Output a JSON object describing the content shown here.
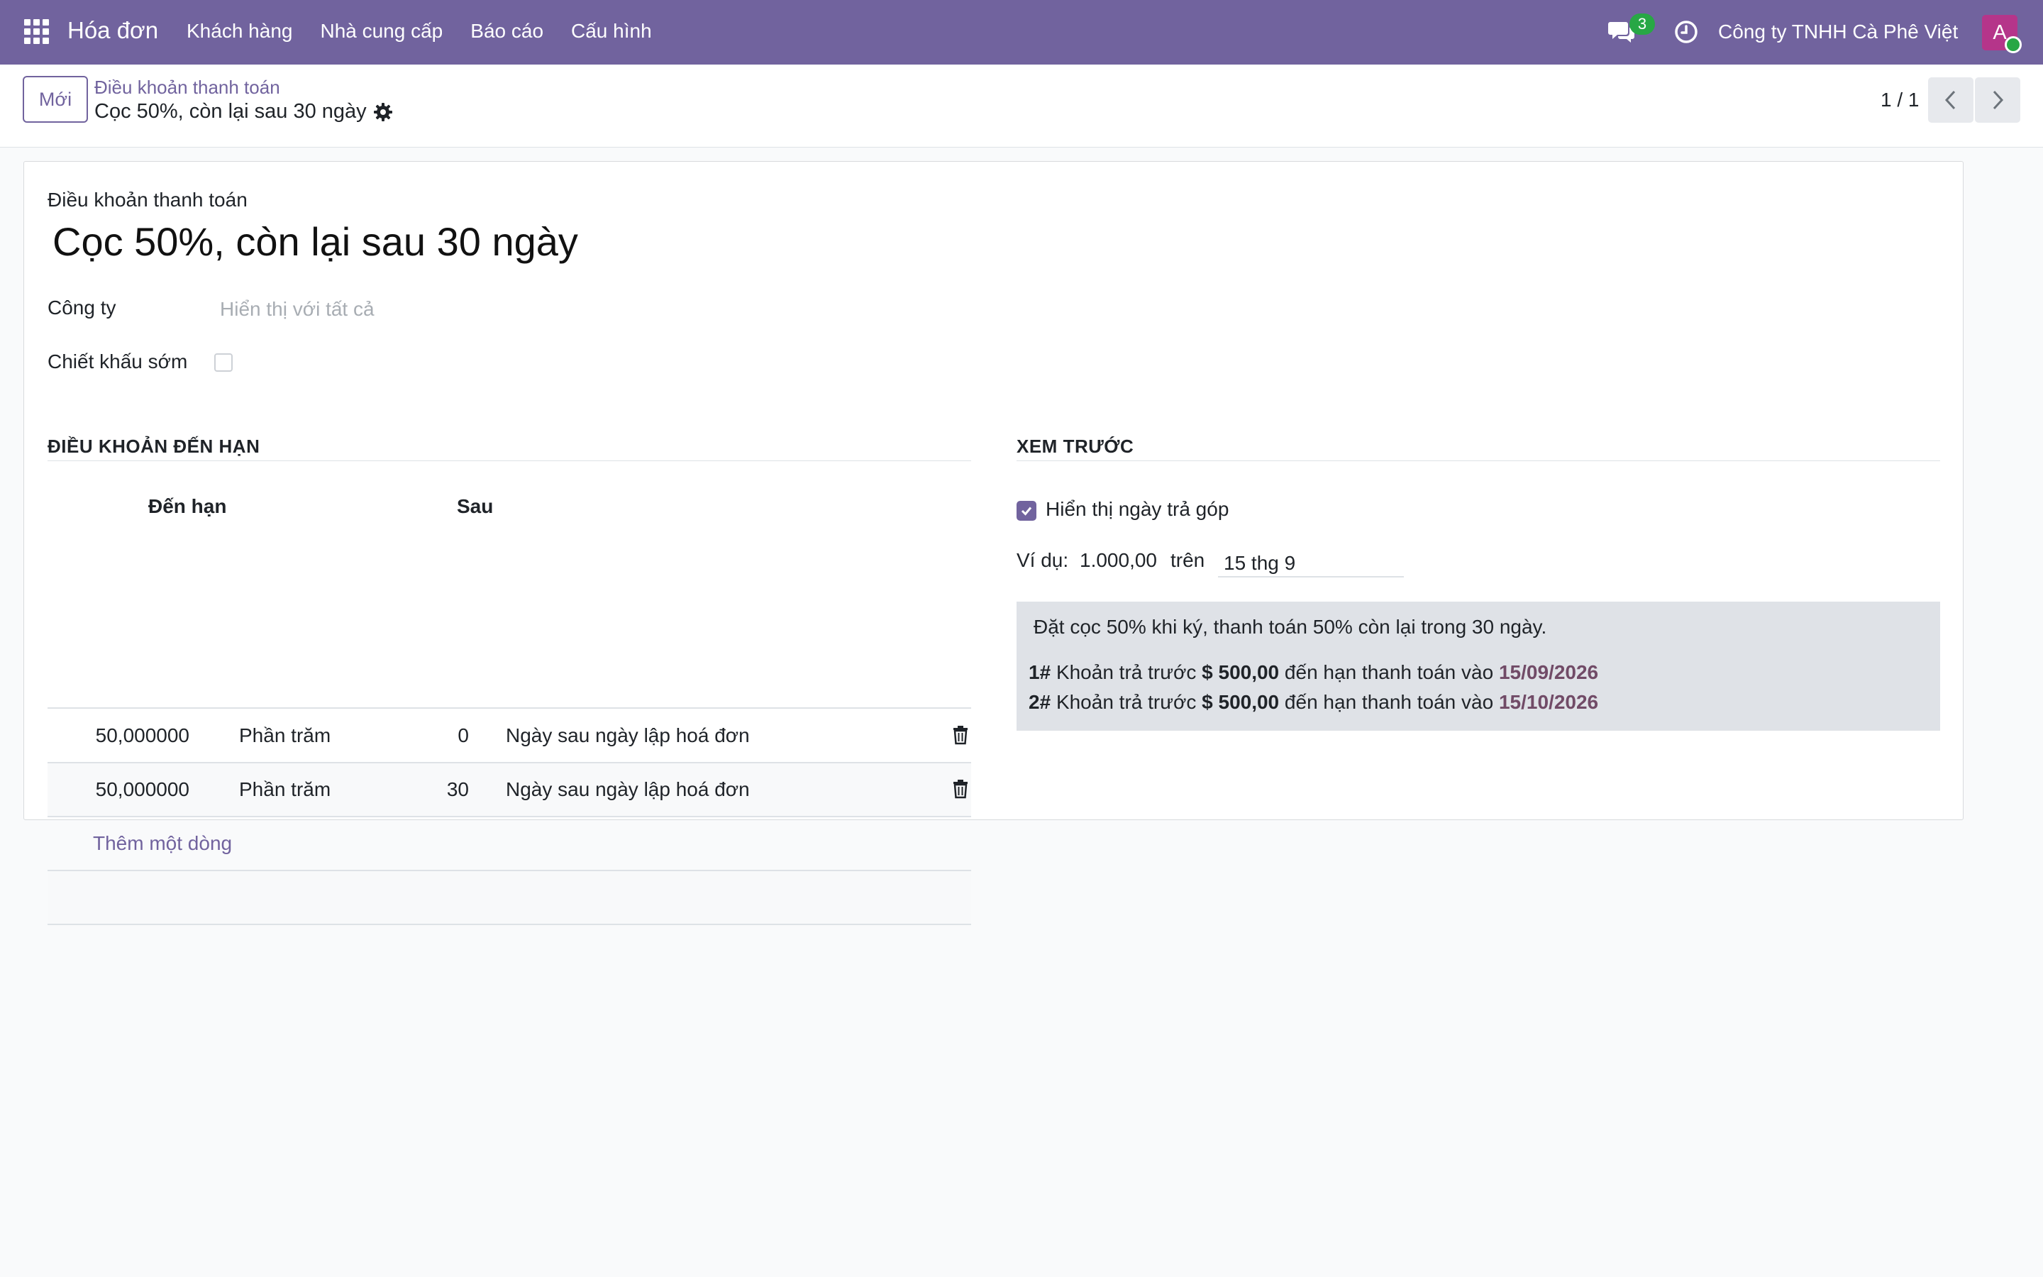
{
  "navbar": {
    "app_name": "Hóa đơn",
    "menu": [
      "Khách hàng",
      "Nhà cung cấp",
      "Báo cáo",
      "Cấu hình"
    ],
    "chat_count": "3",
    "company": "Công ty TNHH Cà Phê Việt",
    "avatar_initial": "A",
    "accent_color": "#71639e"
  },
  "control_panel": {
    "new_label": "Mới",
    "breadcrumb_parent": "Điều khoản thanh toán",
    "breadcrumb_current": "Cọc 50%, còn lại sau 30 ngày",
    "pager": "1 / 1"
  },
  "form": {
    "record_label": "Điều khoản thanh toán",
    "record_name": "Cọc 50%, còn lại sau 30 ngày",
    "company_label": "Công ty",
    "company_placeholder": "Hiển thị với tất cả",
    "early_discount_label": "Chiết khấu sớm",
    "early_discount_checked": false
  },
  "due_terms": {
    "section_title": "ĐIỀU KHOẢN ĐẾN HẠN",
    "headers": {
      "due": "Đến hạn",
      "after": "Sau"
    },
    "rows": [
      {
        "value": "50,000000",
        "unit": "Phần trăm",
        "days": "0",
        "option": "Ngày sau ngày lập hoá đơn"
      },
      {
        "value": "50,000000",
        "unit": "Phần trăm",
        "days": "30",
        "option": "Ngày sau ngày lập hoá đơn"
      }
    ],
    "add_line": "Thêm một dòng"
  },
  "preview": {
    "section_title": "XEM TRƯỚC",
    "show_installments_label": "Hiển thị ngày trả góp",
    "show_installments_checked": true,
    "example_label": "Ví dụ:",
    "example_amount": "1.000,00",
    "example_on": "trên",
    "example_date": "15 thg 9",
    "note": "Đặt cọc 50% khi ký, thanh toán 50% còn lại trong 30 ngày.",
    "installments": [
      {
        "index": "1#",
        "text": "Khoản trả trước",
        "amount": "$ 500,00",
        "due_text": "đến hạn thanh toán vào",
        "date": "15/09/2026"
      },
      {
        "index": "2#",
        "text": "Khoản trả trước",
        "amount": "$ 500,00",
        "due_text": "đến hạn thanh toán vào",
        "date": "15/10/2026"
      }
    ]
  }
}
